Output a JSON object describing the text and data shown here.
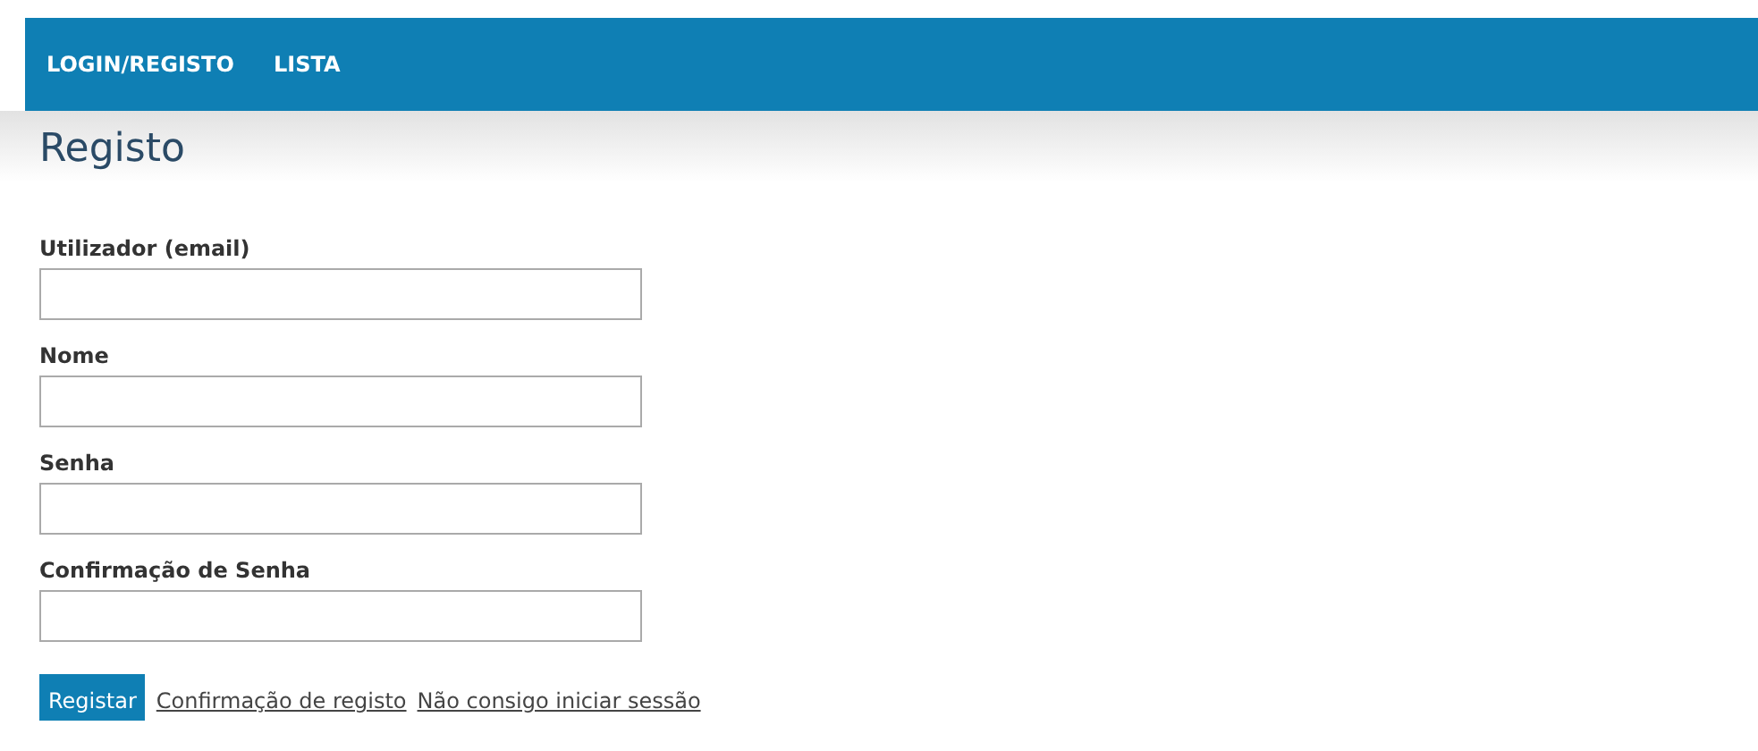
{
  "nav": {
    "items": [
      {
        "label": "LOGIN/REGISTO"
      },
      {
        "label": "LISTA"
      }
    ]
  },
  "page_title": "Registo",
  "fields": [
    {
      "label": "Utilizador (email)"
    },
    {
      "label": "Nome"
    },
    {
      "label": "Senha"
    },
    {
      "label": "Confirmação de Senha"
    }
  ],
  "submit_button": "Registar",
  "links": [
    "Confirmação de registo",
    "Não consigo iniciar sessão"
  ]
}
